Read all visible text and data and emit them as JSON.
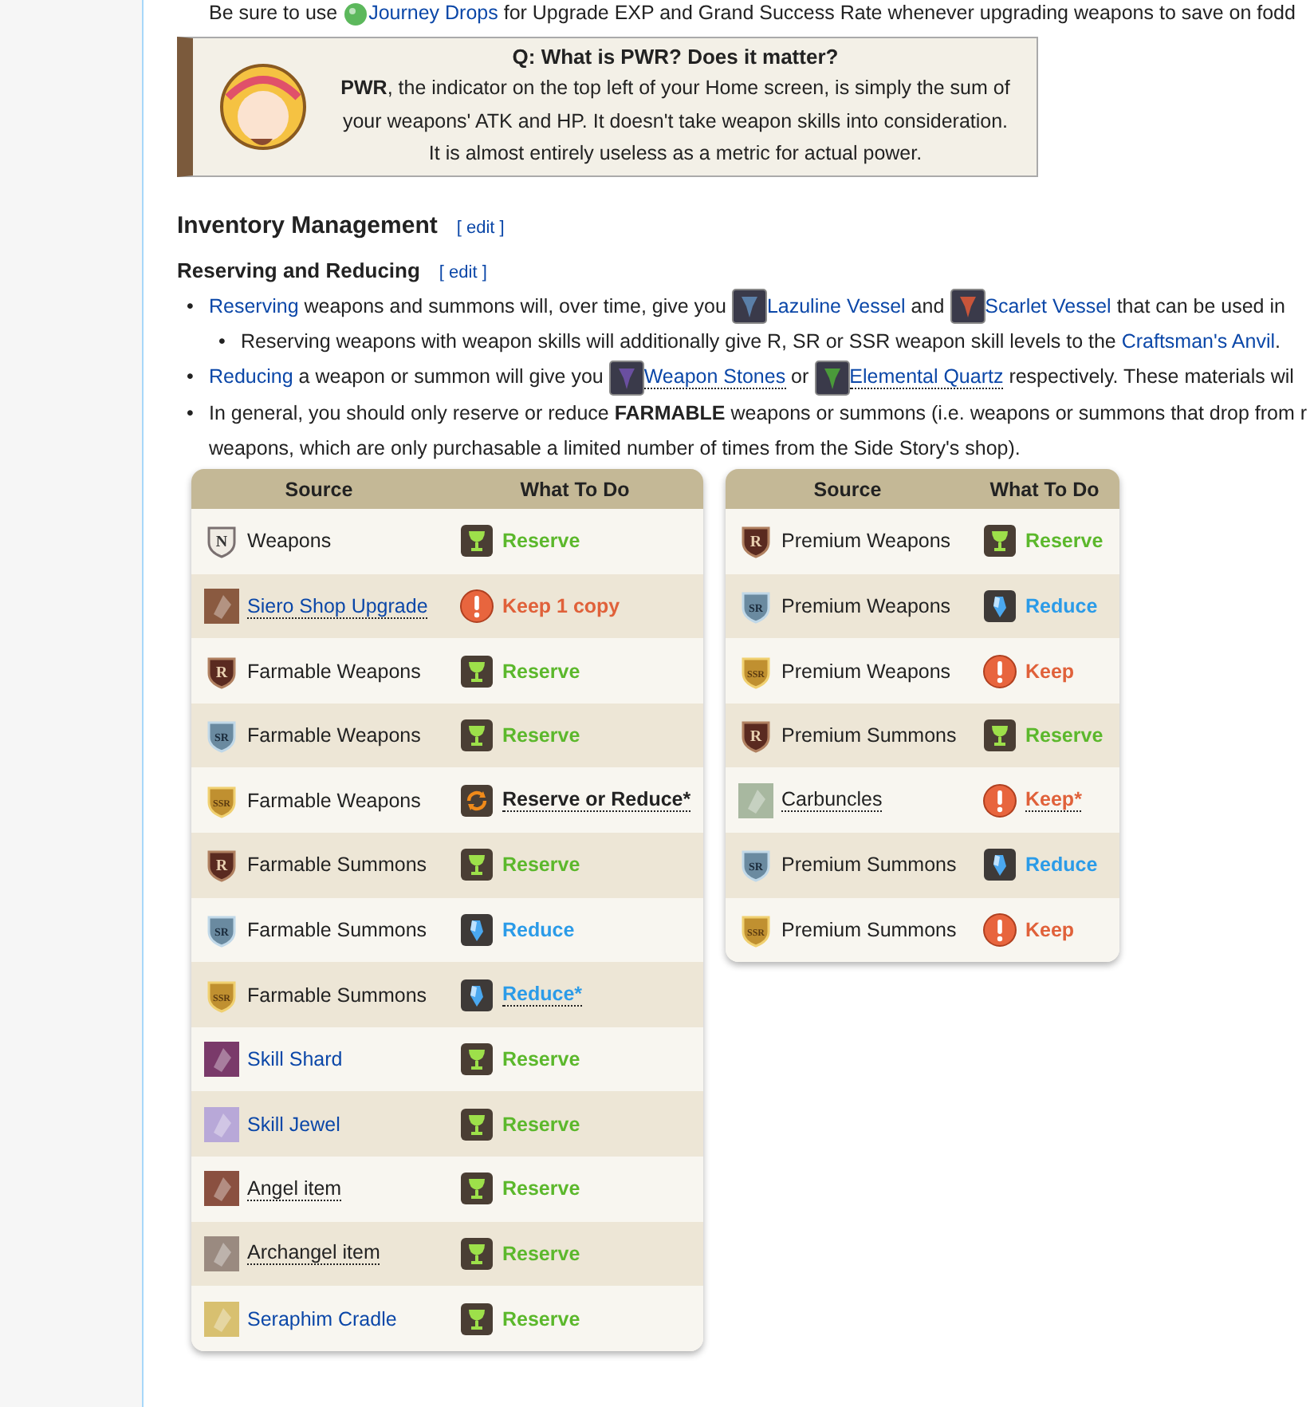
{
  "top_line": [
    {
      "kind": "text",
      "text": "Be sure to use "
    },
    {
      "kind": "icon",
      "color": "#5cb85c"
    },
    {
      "kind": "link",
      "text": "Journey Drops"
    },
    {
      "kind": "text",
      "text": " for Upgrade EXP and Grand Success Rate whenever upgrading weapons to save on fodd"
    }
  ],
  "callout": {
    "title": "Q: What is PWR? Does it matter?",
    "lines": [
      "**PWR**, the indicator on the top left of your Home screen, is simply the sum of",
      "your weapons' ATK and HP. It doesn't take weapon skills into consideration.",
      "It is almost entirely useless as a metric for actual power."
    ]
  },
  "section": {
    "title": "Inventory Management",
    "edit": "[ edit ]"
  },
  "subsection": {
    "title": "Reserving and Reducing",
    "edit": "[ edit ]"
  },
  "bullets": [
    {
      "marker": "•",
      "segments": [
        {
          "kind": "link",
          "text": "Reserving"
        },
        {
          "kind": "text",
          "text": " weapons and summons will, over time, give you "
        },
        {
          "kind": "icon",
          "color": "#5a7fa8"
        },
        {
          "kind": "link",
          "text": "Lazuline Vessel"
        },
        {
          "kind": "text",
          "text": " and "
        },
        {
          "kind": "icon",
          "color": "#c8553a"
        },
        {
          "kind": "link",
          "text": "Scarlet Vessel"
        },
        {
          "kind": "text",
          "text": " that can be used in"
        }
      ],
      "children": [
        {
          "marker": "•",
          "segments": [
            {
              "kind": "text",
              "text": "Reserving weapons with weapon skills will additionally give R, SR or SSR weapon skill levels to the "
            },
            {
              "kind": "link",
              "text": "Craftsman's Anvil"
            },
            {
              "kind": "text",
              "text": "."
            }
          ]
        }
      ]
    },
    {
      "marker": "•",
      "segments": [
        {
          "kind": "link",
          "text": "Reducing"
        },
        {
          "kind": "text",
          "text": " a weapon or summon will give you "
        },
        {
          "kind": "icon",
          "color": "#6a4fa0"
        },
        {
          "kind": "dotted",
          "text": "Weapon Stones"
        },
        {
          "kind": "text",
          "text": " or "
        },
        {
          "kind": "icon",
          "color": "#4a9a3a"
        },
        {
          "kind": "dotted",
          "text": "Elemental Quartz"
        },
        {
          "kind": "text",
          "text": " respectively. These materials wil"
        }
      ]
    },
    {
      "marker": "•",
      "segments": [
        {
          "kind": "text",
          "text": "In general, you should only reserve or reduce **FARMABLE** weapons or summons (i.e. weapons or summons that drop from r"
        },
        {
          "kind": "break"
        },
        {
          "kind": "text",
          "text": "weapons, which are only purchasable a limited number of times from the Side Story's shop)."
        }
      ]
    }
  ],
  "tables": [
    {
      "columns": [
        "Source",
        "What To Do"
      ],
      "rows": [
        {
          "icon": {
            "kind": "badge",
            "text": "N"
          },
          "source": {
            "text": "Weapons",
            "kind": "plain"
          },
          "action": {
            "kind": "reserve",
            "text": "Reserve",
            "dotted": false
          }
        },
        {
          "icon": {
            "kind": "item",
            "color": "#8a5a40"
          },
          "source": {
            "text": "Siero Shop Upgrade",
            "kind": "dotted-link"
          },
          "action": {
            "kind": "keep",
            "text": "Keep 1 copy",
            "dotted": false
          }
        },
        {
          "icon": {
            "kind": "badge",
            "text": "R"
          },
          "source": {
            "text": "Farmable Weapons",
            "kind": "plain"
          },
          "action": {
            "kind": "reserve",
            "text": "Reserve",
            "dotted": false
          }
        },
        {
          "icon": {
            "kind": "badge",
            "text": "SR"
          },
          "source": {
            "text": "Farmable Weapons",
            "kind": "plain"
          },
          "action": {
            "kind": "reserve",
            "text": "Reserve",
            "dotted": false
          }
        },
        {
          "icon": {
            "kind": "badge",
            "text": "SSR"
          },
          "source": {
            "text": "Farmable Weapons",
            "kind": "plain"
          },
          "action": {
            "kind": "either",
            "text": "Reserve or Reduce*",
            "dotted": true
          }
        },
        {
          "icon": {
            "kind": "badge",
            "text": "R"
          },
          "source": {
            "text": "Farmable Summons",
            "kind": "plain"
          },
          "action": {
            "kind": "reserve",
            "text": "Reserve",
            "dotted": false
          }
        },
        {
          "icon": {
            "kind": "badge",
            "text": "SR"
          },
          "source": {
            "text": "Farmable Summons",
            "kind": "plain"
          },
          "action": {
            "kind": "reduce",
            "text": "Reduce",
            "dotted": false
          }
        },
        {
          "icon": {
            "kind": "badge",
            "text": "SSR"
          },
          "source": {
            "text": "Farmable Summons",
            "kind": "plain"
          },
          "action": {
            "kind": "reduce",
            "text": "Reduce*",
            "dotted": true
          }
        },
        {
          "icon": {
            "kind": "item",
            "color": "#7a3a6a"
          },
          "source": {
            "text": "Skill Shard",
            "kind": "link"
          },
          "action": {
            "kind": "reserve",
            "text": "Reserve",
            "dotted": false
          }
        },
        {
          "icon": {
            "kind": "item",
            "color": "#b8a8d8"
          },
          "source": {
            "text": "Skill Jewel",
            "kind": "link"
          },
          "action": {
            "kind": "reserve",
            "text": "Reserve",
            "dotted": false
          }
        },
        {
          "icon": {
            "kind": "item",
            "color": "#8a5040"
          },
          "source": {
            "text": "Angel item",
            "kind": "dotted"
          },
          "action": {
            "kind": "reserve",
            "text": "Reserve",
            "dotted": false
          }
        },
        {
          "icon": {
            "kind": "item",
            "color": "#9a8a80"
          },
          "source": {
            "text": "Archangel item",
            "kind": "dotted"
          },
          "action": {
            "kind": "reserve",
            "text": "Reserve",
            "dotted": false
          }
        },
        {
          "icon": {
            "kind": "item",
            "color": "#d8c070"
          },
          "source": {
            "text": "Seraphim Cradle",
            "kind": "link"
          },
          "action": {
            "kind": "reserve",
            "text": "Reserve",
            "dotted": false
          }
        }
      ]
    },
    {
      "columns": [
        "Source",
        "What To Do"
      ],
      "rows": [
        {
          "icon": {
            "kind": "badge",
            "text": "R"
          },
          "source": {
            "text": "Premium Weapons",
            "kind": "plain"
          },
          "action": {
            "kind": "reserve",
            "text": "Reserve",
            "dotted": false
          }
        },
        {
          "icon": {
            "kind": "badge",
            "text": "SR"
          },
          "source": {
            "text": "Premium Weapons",
            "kind": "plain"
          },
          "action": {
            "kind": "reduce",
            "text": "Reduce",
            "dotted": false
          }
        },
        {
          "icon": {
            "kind": "badge",
            "text": "SSR"
          },
          "source": {
            "text": "Premium Weapons",
            "kind": "plain"
          },
          "action": {
            "kind": "keep",
            "text": "Keep",
            "dotted": false
          }
        },
        {
          "icon": {
            "kind": "badge",
            "text": "R"
          },
          "source": {
            "text": "Premium Summons",
            "kind": "plain"
          },
          "action": {
            "kind": "reserve",
            "text": "Reserve",
            "dotted": false
          }
        },
        {
          "icon": {
            "kind": "item",
            "color": "#a8b8a0"
          },
          "source": {
            "text": "Carbuncles",
            "kind": "dotted"
          },
          "action": {
            "kind": "keep",
            "text": "Keep*",
            "dotted": true
          }
        },
        {
          "icon": {
            "kind": "badge",
            "text": "SR"
          },
          "source": {
            "text": "Premium Summons",
            "kind": "plain"
          },
          "action": {
            "kind": "reduce",
            "text": "Reduce",
            "dotted": false
          }
        },
        {
          "icon": {
            "kind": "badge",
            "text": "SSR"
          },
          "source": {
            "text": "Premium Summons",
            "kind": "plain"
          },
          "action": {
            "kind": "keep",
            "text": "Keep",
            "dotted": false
          }
        }
      ]
    }
  ]
}
